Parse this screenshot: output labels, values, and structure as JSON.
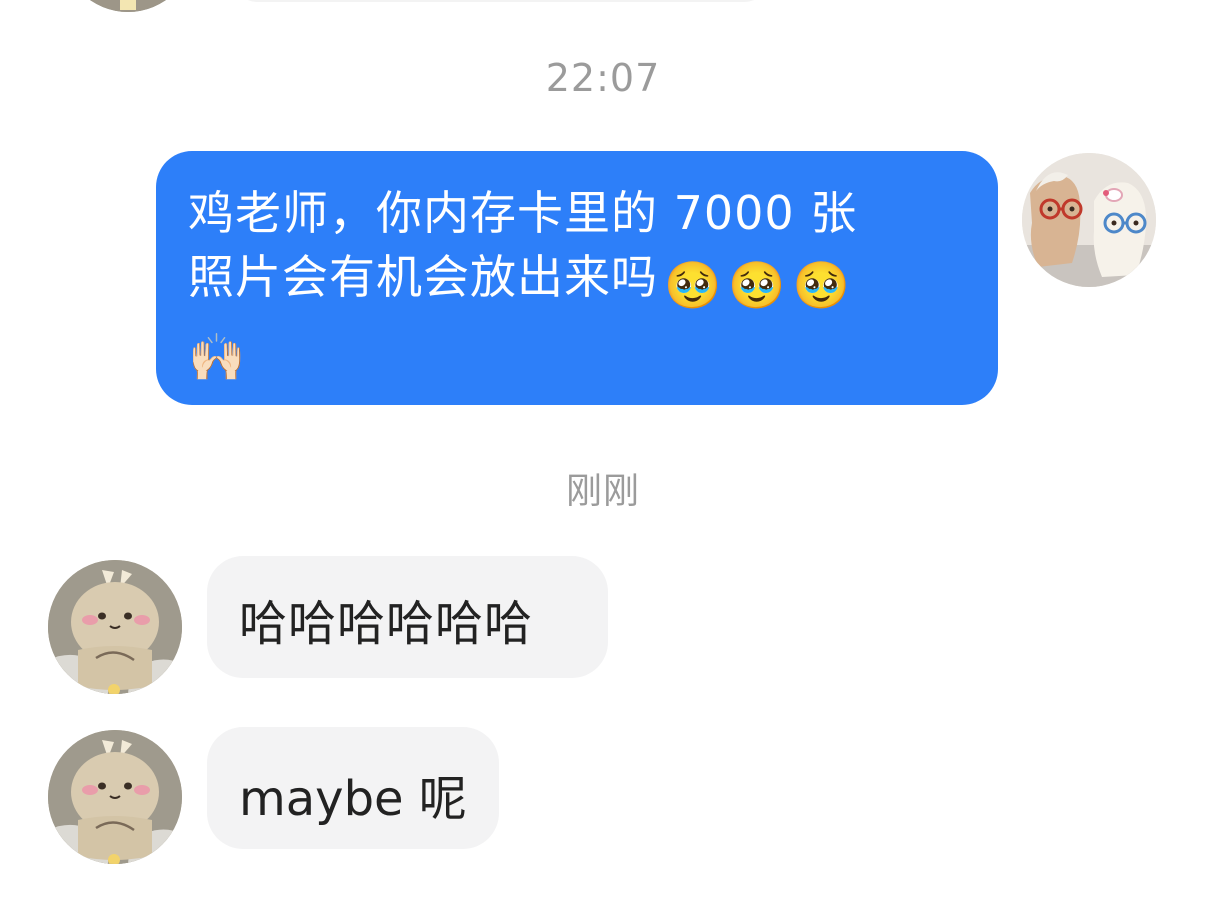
{
  "timestamps": {
    "first": "22:07",
    "second": "刚刚"
  },
  "messages": [
    {
      "direction": "outgoing",
      "line1": "鸡老师，你内存卡里的 7000 张",
      "line2": "照片会有机会放出来吗",
      "emojis_line2": [
        "🥹",
        "🥹",
        "🥹"
      ],
      "emoji_line3": "🙌🏻"
    },
    {
      "direction": "incoming",
      "text": "哈哈哈哈哈哈"
    },
    {
      "direction": "incoming",
      "text": "maybe 呢"
    }
  ],
  "avatars": {
    "me": "avatar-two-horse-figurines-with-glasses",
    "other": "avatar-cartoon-rabbit"
  },
  "colors": {
    "outgoing_bubble": "#2d7ff9",
    "incoming_bubble": "#f3f3f4",
    "timestamp_text": "#9b9b9b"
  }
}
